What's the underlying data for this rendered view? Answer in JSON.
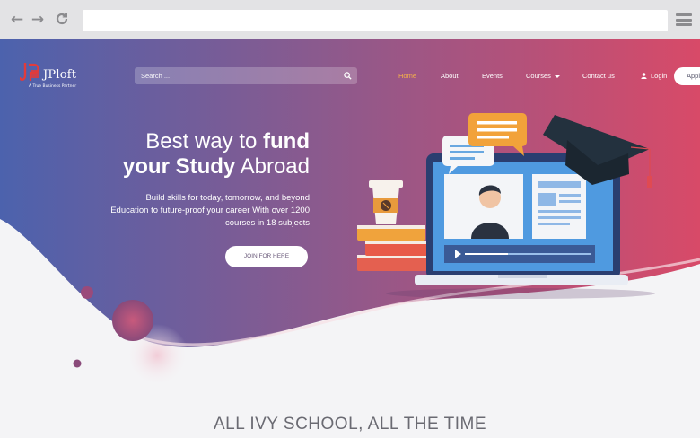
{
  "browser": {
    "back_icon": "arrow-left-icon",
    "forward_icon": "arrow-right-icon",
    "reload_icon": "reload-icon",
    "menu_icon": "hamburger-menu-icon",
    "url": ""
  },
  "header": {
    "logo_text": "JPloft",
    "logo_tagline": "A True Business Partner",
    "search_placeholder": "Search ...",
    "nav": [
      {
        "label": "Home",
        "active": true
      },
      {
        "label": "About",
        "active": false
      },
      {
        "label": "Events",
        "active": false
      },
      {
        "label": "Courses",
        "active": false
      },
      {
        "label": "Contact us",
        "active": false
      }
    ],
    "login_label": "Login",
    "apply_label": "Apply"
  },
  "hero": {
    "headline_line1_light": "Best way to ",
    "headline_line1_bold": "fund",
    "headline_line2_bold": "your Study",
    "headline_line2_light": " Abroad",
    "subtext_line1": "Build skills for today, tomorrow, and beyond",
    "subtext_line2": "Education to future-proof your career With over 1200",
    "subtext_line3": "courses in 18 subjects",
    "cta_label": "JOIN FOR HERE"
  },
  "section": {
    "title": "ALL IVY SCHOOL, ALL THE TIME"
  },
  "colors": {
    "gradient_left": "#4c62ad",
    "gradient_mid": "#8a5a8e",
    "gradient_right": "#d84a68",
    "accent_orange": "#f4a63a",
    "active_nav": "#f4b04a"
  }
}
